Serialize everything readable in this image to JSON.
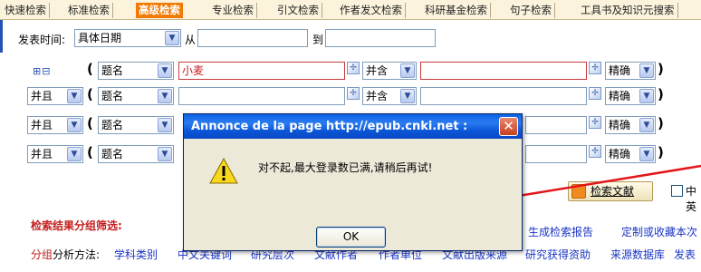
{
  "tabs": [
    {
      "label": "快速检索",
      "active": false
    },
    {
      "label": "标准检索",
      "active": false
    },
    {
      "label": "高级检索",
      "active": true
    },
    {
      "label": "专业检索",
      "active": false
    },
    {
      "label": "引文检索",
      "active": false
    },
    {
      "label": "作者发文检索",
      "active": false
    },
    {
      "label": "科研基金检索",
      "active": false
    },
    {
      "label": "句子检索",
      "active": false
    },
    {
      "label": "工具书及知识元搜索",
      "active": false
    }
  ],
  "publish_time": {
    "label": "发表时间:",
    "type_value": "具体日期",
    "from_label": "从",
    "to_label": "到"
  },
  "rows": [
    {
      "logic": "",
      "field": "题名",
      "value": "小麦",
      "op": "并含",
      "match": "精确"
    },
    {
      "logic": "并且",
      "field": "题名",
      "value": "",
      "op": "并含",
      "match": "精确"
    },
    {
      "logic": "并且",
      "field": "题名",
      "value": "",
      "op": "",
      "match": "精确"
    },
    {
      "logic": "并且",
      "field": "题名",
      "value": "",
      "op": "",
      "match": "精确"
    }
  ],
  "plus_minus": "⊞⊟",
  "search_button": "检索文献",
  "checkbox_label": "中英",
  "results": {
    "title": "检索结果分组筛选:",
    "report_link": "生成检索报告",
    "custom_link": "定制或收藏本次",
    "group_label": "分组",
    "method_label": "分析方法:",
    "links": [
      "学科类别",
      "中文关键词",
      "研究层次",
      "文献作者",
      "作者单位",
      "文献出版来源",
      "研究获得资助",
      "来源数据库",
      "发表"
    ]
  },
  "dialog": {
    "title": "Annonce de la page  http://epub.cnki.net :",
    "message": "对不起,最大登录数已满,请稍后再试!",
    "ok_label": "OK"
  },
  "colors": {
    "active_tab": "#f07b06",
    "title_bar": "#0a55d6",
    "red": "#c51d1d",
    "link": "#1a35c4"
  }
}
